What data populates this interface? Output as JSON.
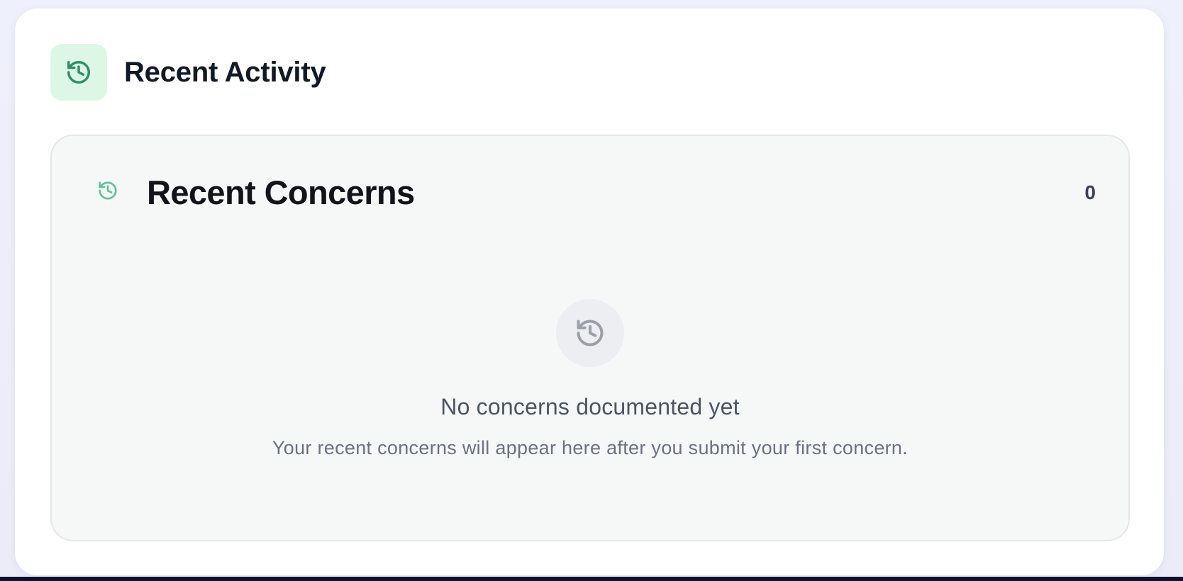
{
  "colors": {
    "accent": "#2f8f66",
    "accent_light": "#5cc49b",
    "accent_bg": "#dcf7e6",
    "muted_icon": "#9aa0aa"
  },
  "card": {
    "title": "Recent Activity",
    "icon": "history-icon"
  },
  "concerns": {
    "title": "Recent Concerns",
    "icon": "history-icon",
    "count": "0",
    "empty": {
      "icon": "history-icon",
      "title": "No concerns documented yet",
      "subtitle": "Your recent concerns will appear here after you submit your first concern."
    }
  }
}
